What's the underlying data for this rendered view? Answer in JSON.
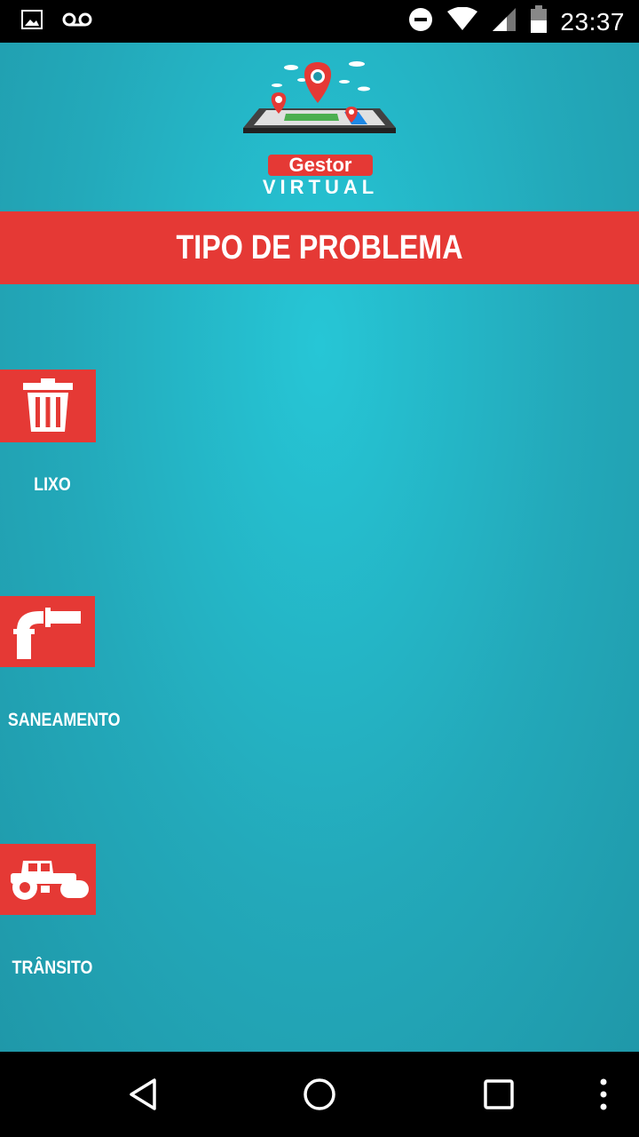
{
  "status_bar": {
    "time": "23:37",
    "icons": [
      "image-icon",
      "voicemail-icon",
      "do-not-disturb-icon",
      "wifi-icon",
      "signal-icon",
      "battery-icon"
    ]
  },
  "logo": {
    "line1": "Gestor",
    "line2": "VIRTUAL"
  },
  "header": {
    "title": "TIPO DE PROBLEMA"
  },
  "categories": [
    {
      "label": "LIXO",
      "icon": "trash-can-icon"
    },
    {
      "label": "SANEAMENTO",
      "icon": "pipe-icon"
    },
    {
      "label": "TRÂNSITO",
      "icon": "road-roller-icon"
    }
  ],
  "nav_bar": {
    "icons": [
      "back-icon",
      "home-icon",
      "recents-icon",
      "overflow-menu-icon"
    ]
  },
  "colors": {
    "accent": "#e53935",
    "background": "#23a9ba",
    "text": "#ffffff"
  }
}
